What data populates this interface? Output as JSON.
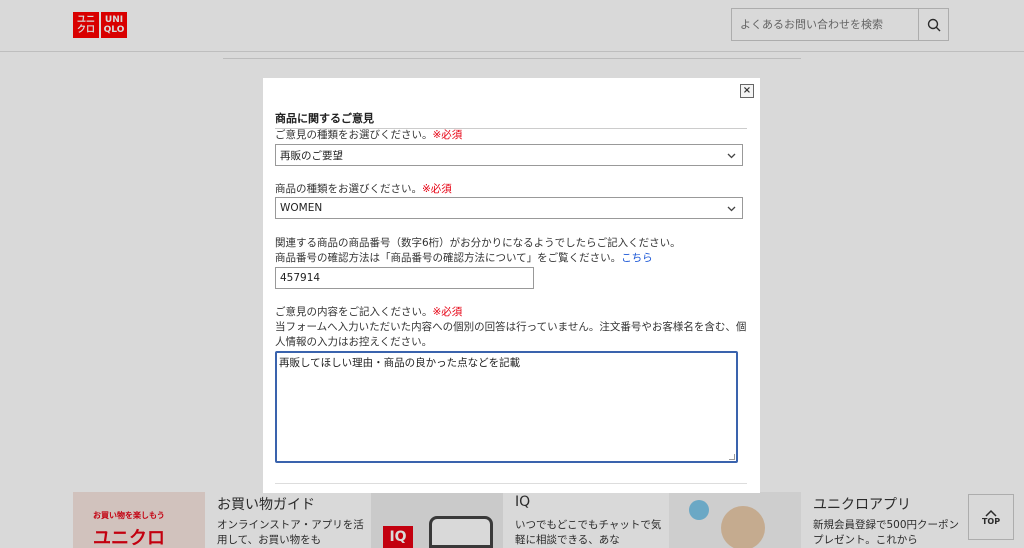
{
  "header": {
    "logo_top": "ユニ\nクロ",
    "logo_bottom": "UNI\nQLO",
    "search_placeholder": "よくあるお問い合わせを検索"
  },
  "footer": {
    "promo1": {
      "image_text1": "お買い物を楽しもう",
      "image_text2": "ユニクロ",
      "title": "お買い物ガイド",
      "desc": "オンラインストア・アプリを活用して、お買い物をも"
    },
    "promo2": {
      "image_text": "IQ",
      "title": "IQ",
      "desc": "いつでもどこでもチャットで気軽に相談できる、あな"
    },
    "promo3": {
      "title": "ユニクロアプリ",
      "desc": "新規会員登録で500円クーポンプレゼント。これから"
    },
    "top_label": "TOP"
  },
  "modal": {
    "close_label": "×",
    "section_title": "商品に関するご意見",
    "q1_label": "ご意見の種類をお選びください。",
    "required": "※必須",
    "q1_value": "再販のご要望",
    "q2_label": "商品の種類をお選びください。",
    "q2_value": "WOMEN",
    "q3_line1": "関連する商品の商品番号（数字6桁）がお分かりになるようでしたらご記入ください。",
    "q3_line2": "商品番号の確認方法は「商品番号の確認方法について」をご覧ください。",
    "q3_link": "こちら",
    "q3_value": "457914",
    "q4_label": "ご意見の内容をご記入ください。",
    "q4_note1": "当フォームへ入力いただいた内容への個別の回答は行っていません。注文番号やお客様名を含む、個",
    "q4_note2": "人情報の入力はお控えください。",
    "q4_value": "再販してほしい理由・商品の良かった点などを記載"
  },
  "colors": {
    "brand": "#ff0000",
    "required": "#e60012",
    "link": "#1a56d6",
    "focus": "#3a63ad"
  }
}
